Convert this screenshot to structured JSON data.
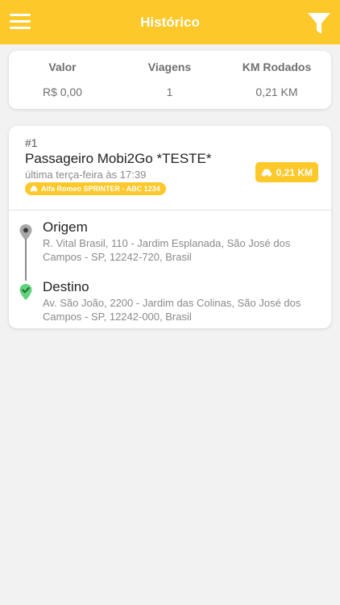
{
  "header": {
    "title": "Histórico",
    "menu_icon": "hamburger-menu-icon",
    "filter_icon": "filter-funnel-icon",
    "color": "#fcc82a"
  },
  "summary": {
    "valor_label": "Valor",
    "valor_value": "R$ 0,00",
    "viagens_label": "Viagens",
    "viagens_value": "1",
    "km_label": "KM Rodados",
    "km_value": "0,21 KM"
  },
  "trip": {
    "number": "#1",
    "passenger": "Passageiro Mobi2Go *TESTE*",
    "date": "última terça-feira às 17:39",
    "vehicle": "Alfa Romeo SPRINTER - ABC 1234",
    "distance": "0,21 KM",
    "origin": {
      "title": "Origem",
      "address": "R. Vital Brasil, 110 - Jardim Esplanada, São José dos Campos - SP, 12242-720, Brasil",
      "icon": "origin-pin-icon"
    },
    "destination": {
      "title": "Destino",
      "address": "Av. São João, 2200 - Jardim das Colinas, São José dos Campos - SP, 12242-000, Brasil",
      "icon": "destination-check-pin-icon"
    }
  },
  "colors": {
    "accent": "#fcc82a",
    "destination_green": "#5fd27a"
  }
}
